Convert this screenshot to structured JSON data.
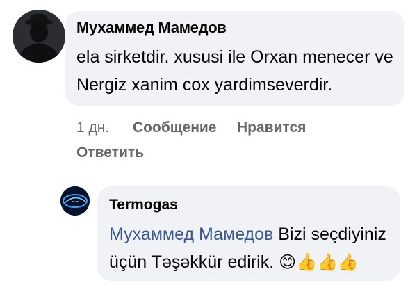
{
  "comment": {
    "author": "Мухаммед Мамедов",
    "text": "ela sirketdir. xususi ile Orxan menecer ve Nergiz xanim cox yardimseverdir.",
    "time": "1 дн.",
    "actions": {
      "message": "Сообщение",
      "like": "Нравится",
      "reply": "Ответить"
    }
  },
  "reply": {
    "author": "Termogas",
    "mention": "Мухаммед Мамедов",
    "text": " Bizi seçdiyiniz üçün Təşəkkür edirik. ",
    "emojis": "😊👍👍👍",
    "emoji_names": [
      "smiling-face-emoji",
      "thumbs-up-emoji",
      "thumbs-up-emoji",
      "thumbs-up-emoji"
    ]
  },
  "colors": {
    "bubble": "#f0f2f5",
    "mention": "#385898",
    "secondary_text": "#65676b"
  }
}
